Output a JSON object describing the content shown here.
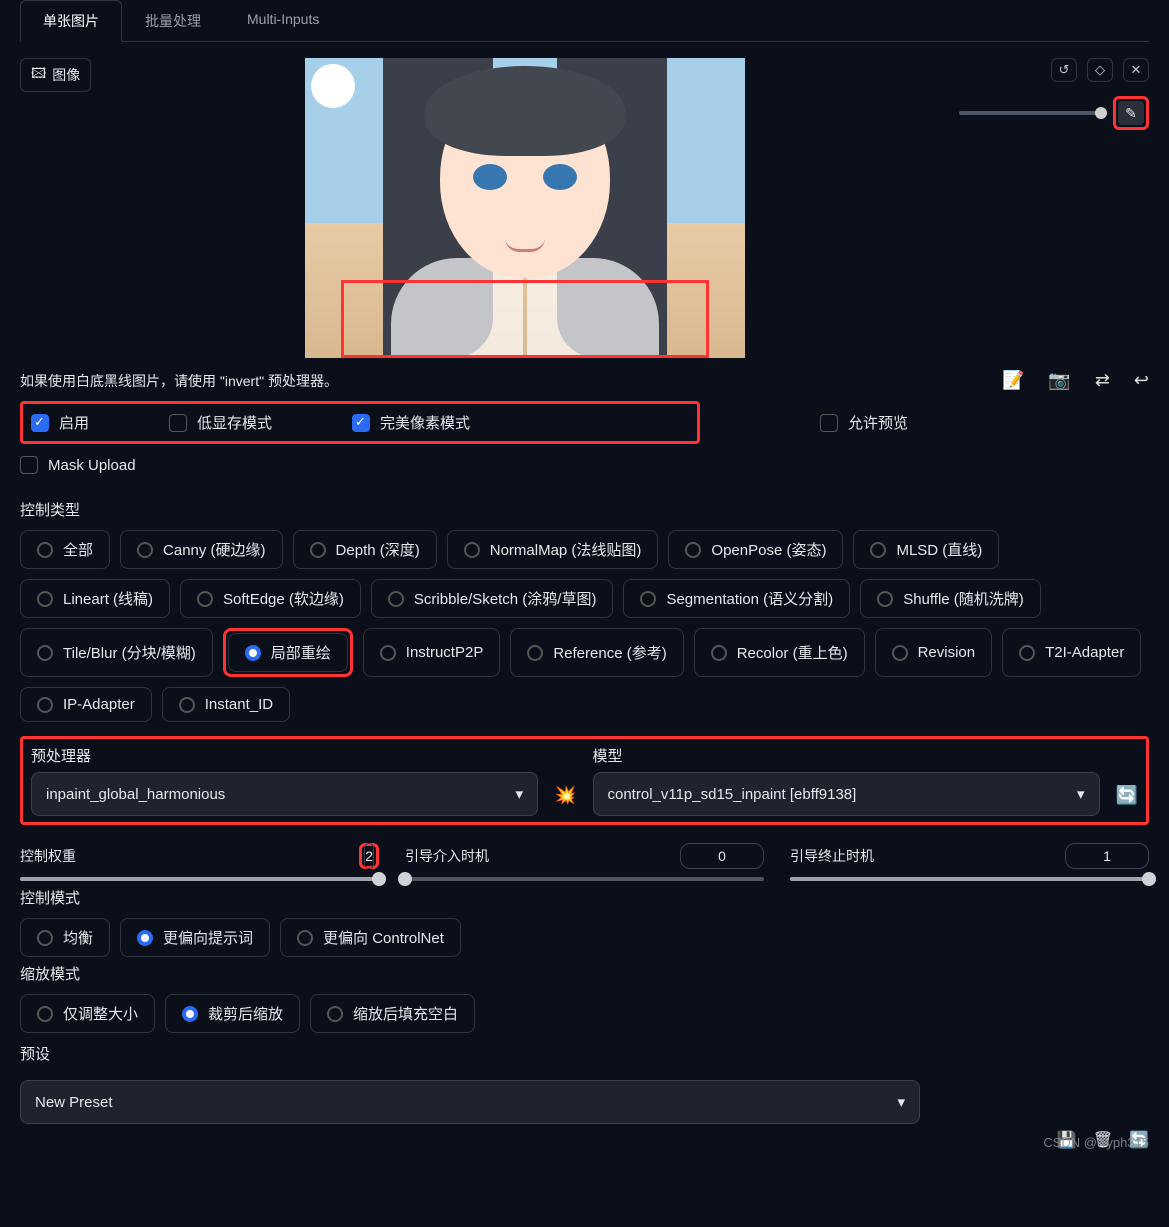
{
  "tabs": {
    "single": "单张图片",
    "batch": "批量处理",
    "multi": "Multi-Inputs"
  },
  "image_tag": "图像",
  "hint": "如果使用白底黑线图片，请使用 \"invert\" 预处理器。",
  "checks": {
    "enable": "启用",
    "lowvram": "低显存模式",
    "pixel_perfect": "完美像素模式",
    "allow_preview": "允许预览",
    "mask_upload": "Mask Upload"
  },
  "control_type_label": "控制类型",
  "control_types": [
    "全部",
    "Canny (硬边缘)",
    "Depth (深度)",
    "NormalMap (法线贴图)",
    "OpenPose (姿态)",
    "MLSD (直线)",
    "Lineart (线稿)",
    "SoftEdge (软边缘)",
    "Scribble/Sketch (涂鸦/草图)",
    "Segmentation (语义分割)",
    "Shuffle (随机洗牌)",
    "Tile/Blur (分块/模糊)",
    "局部重绘",
    "InstructP2P",
    "Reference (参考)",
    "Recolor (重上色)",
    "Revision",
    "T2I-Adapter",
    "IP-Adapter",
    "Instant_ID"
  ],
  "control_type_selected": "局部重绘",
  "preprocessor": {
    "label": "预处理器",
    "value": "inpaint_global_harmonious"
  },
  "model": {
    "label": "模型",
    "value": "control_v11p_sd15_inpaint [ebff9138]"
  },
  "sliders": {
    "weight": {
      "label": "控制权重",
      "value": "2",
      "fill_pct": 100
    },
    "start": {
      "label": "引导介入时机",
      "value": "0",
      "fill_pct": 0
    },
    "end": {
      "label": "引导终止时机",
      "value": "1",
      "fill_pct": 100
    }
  },
  "control_mode": {
    "label": "控制模式",
    "opts": [
      "均衡",
      "更偏向提示词",
      "更偏向 ControlNet"
    ],
    "selected": "更偏向提示词"
  },
  "resize_mode": {
    "label": "缩放模式",
    "opts": [
      "仅调整大小",
      "裁剪后缩放",
      "缩放后填充空白"
    ],
    "selected": "裁剪后缩放"
  },
  "preset": {
    "label": "预设",
    "value": "New Preset"
  },
  "watermark": "CSDN @wyph315"
}
